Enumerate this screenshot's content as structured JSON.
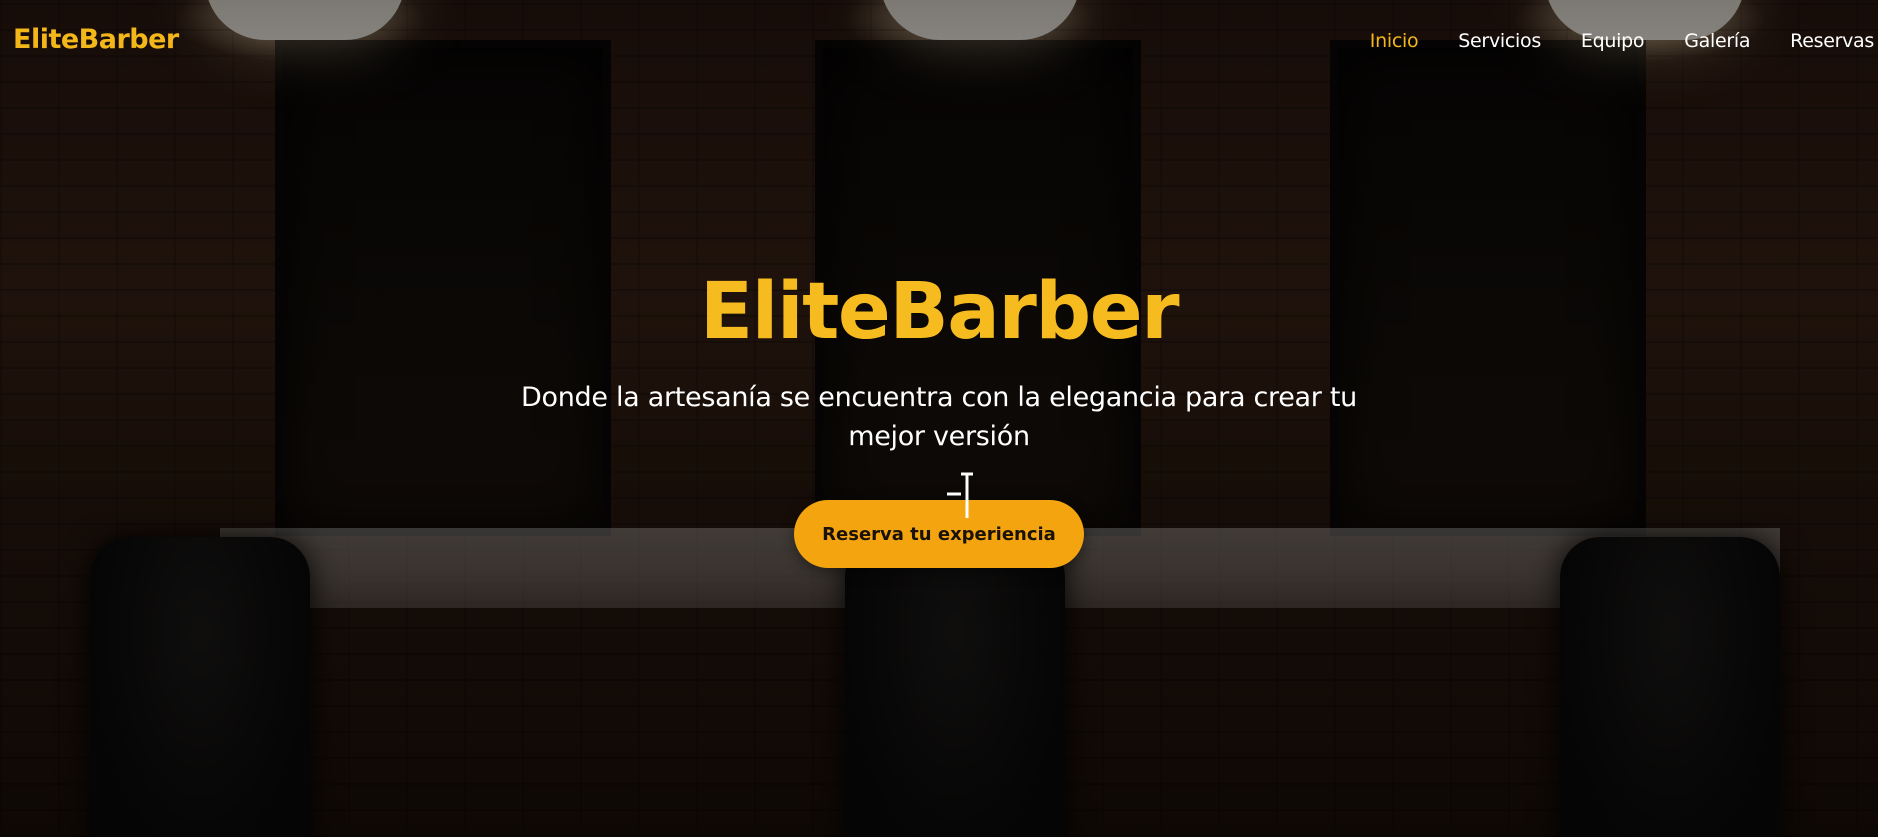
{
  "brand": {
    "name": "EliteBarber",
    "accent_color": "#f3b719"
  },
  "nav": {
    "items": [
      {
        "label": "Inicio",
        "active": true
      },
      {
        "label": "Servicios",
        "active": false
      },
      {
        "label": "Equipo",
        "active": false
      },
      {
        "label": "Galería",
        "active": false
      },
      {
        "label": "Reservas",
        "active": false
      }
    ]
  },
  "hero": {
    "title": "EliteBarber",
    "subtitle": "Donde la artesanía se encuentra con la elegancia para crear tu mejor versión",
    "cta_label": "Reserva tu experiencia",
    "cta_color": "#f3a40f",
    "background": "barbershop-interior-photo"
  },
  "cursor": {
    "icon": "text-cursor-icon"
  }
}
